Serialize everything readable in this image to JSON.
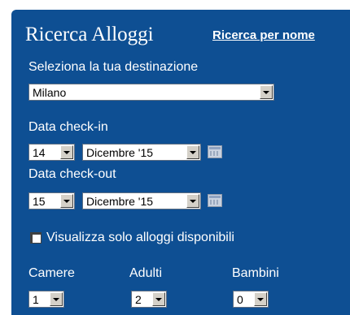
{
  "header": {
    "title": "Ricerca Alloggi",
    "name_search_link": "Ricerca per nome"
  },
  "destination": {
    "label": "Seleziona la tua destinazione",
    "value": "Milano"
  },
  "checkin": {
    "label": "Data check-in",
    "day": "14",
    "month": "Dicembre '15"
  },
  "checkout": {
    "label": "Data check-out",
    "day": "15",
    "month": "Dicembre '15"
  },
  "availability": {
    "label": "Visualizza solo alloggi disponibili",
    "checked": false
  },
  "occupancy": {
    "rooms": {
      "label": "Camere",
      "value": "1"
    },
    "adults": {
      "label": "Adulti",
      "value": "2"
    },
    "children": {
      "label": "Bambini",
      "value": "0"
    }
  },
  "icons": {
    "dropdown": "chevron-down-icon",
    "calendar": "calendar-icon"
  },
  "colors": {
    "panel": "#0e4f93",
    "text": "#ffffff"
  }
}
